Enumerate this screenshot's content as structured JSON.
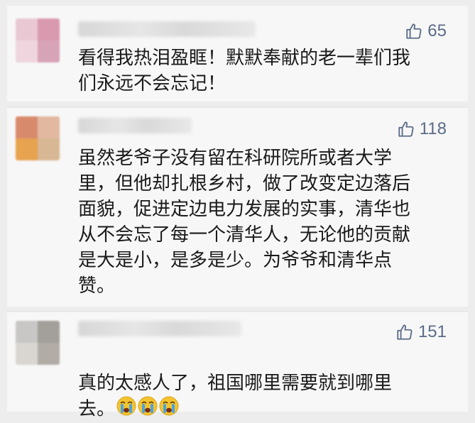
{
  "comments": [
    {
      "likes": "65",
      "text": "看得我热泪盈眶！默默奉献的老一辈们我\n们永远不会忘记！",
      "avatar_colors": [
        "#e9c8d3",
        "#d99aaf",
        "#efd6de",
        "#d7a3b7"
      ]
    },
    {
      "likes": "118",
      "text": "虽然老爷子没有留在科研院所或者大学\n里，但他却扎根乡村，做了改变定边落后\n面貌，促进定边电力发展的实事，清华也\n从不会忘了每一个清华人，无论他的贡献\n是大是小，是多是少。为爷爷和清华点\n赞。",
      "avatar_colors": [
        "#d88a6d",
        "#e2b8a0",
        "#e7a34f",
        "#d7b794"
      ]
    },
    {
      "likes": "151",
      "text": "真的太感人了，祖国哪里需要就到哪里\n去。",
      "emoji_count": 3,
      "emoji_name": "crying-face",
      "avatar_colors": [
        "#c8c7c6",
        "#a3a09c",
        "#d9d6d2",
        "#b1aca6"
      ]
    }
  ],
  "colors": {
    "like_color": "#5b6c88",
    "text_color": "#1a1a1a",
    "card_bg": "#f7f7f7",
    "emoji_yellow": "#f4c430",
    "tear_blue": "#4aa3e0"
  },
  "icons": {
    "like": "thumbs-up-icon"
  }
}
